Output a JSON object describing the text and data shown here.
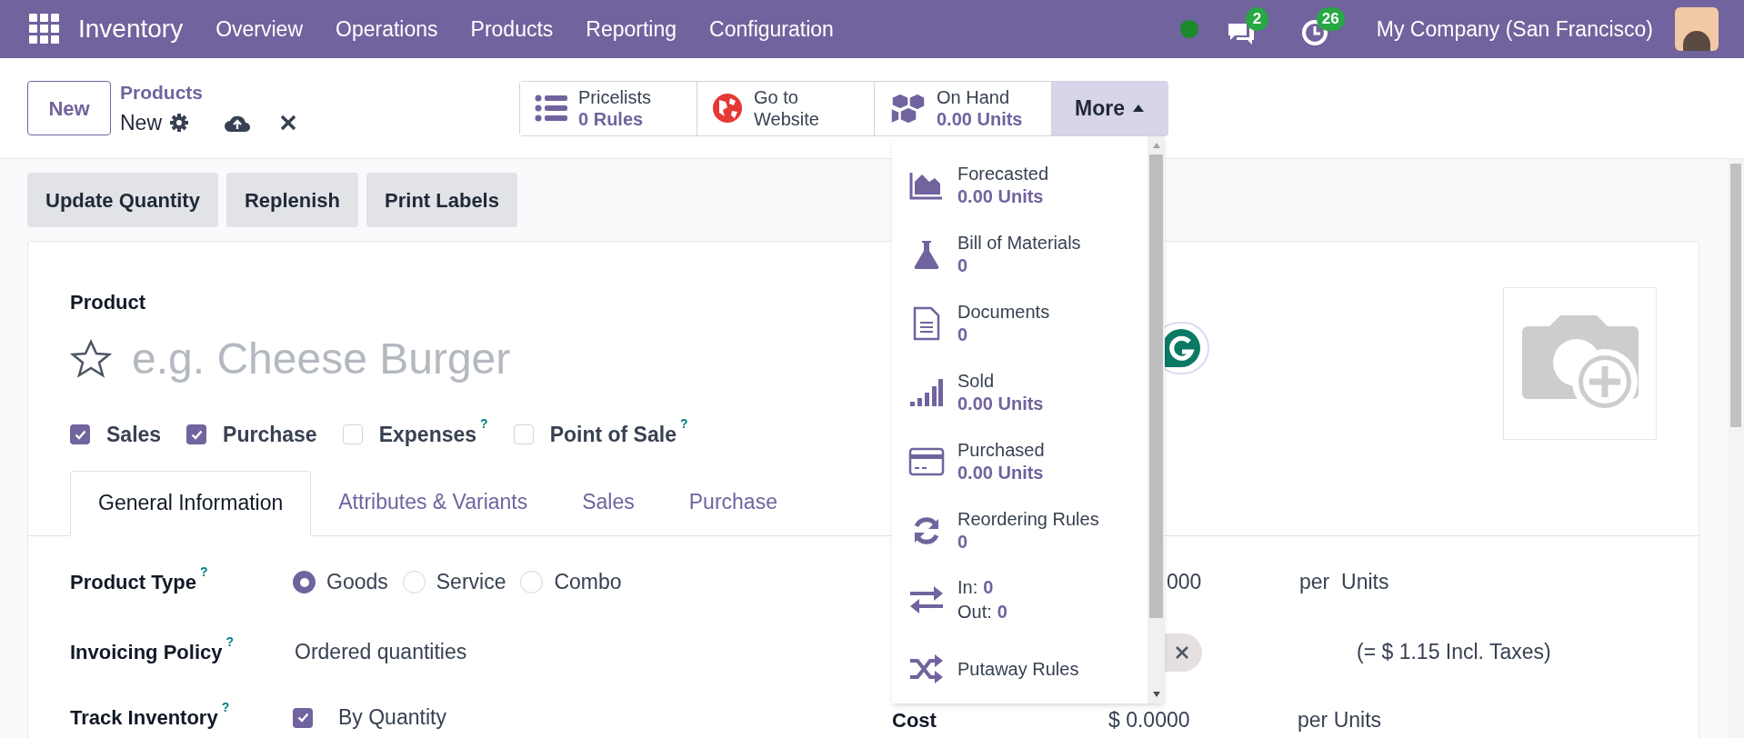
{
  "navbar": {
    "app_name": "Inventory",
    "menu": [
      "Overview",
      "Operations",
      "Products",
      "Reporting",
      "Configuration"
    ],
    "messages_count": "2",
    "activities_count": "26",
    "company": "My Company (San Francisco)"
  },
  "control_panel": {
    "new_button": "New",
    "breadcrumb": "Products",
    "record": "New"
  },
  "smart_buttons": [
    {
      "label": "Pricelists",
      "value": "0",
      "unit": "Rules"
    },
    {
      "label": "Go to",
      "value": "Website"
    },
    {
      "label": "On Hand",
      "value": "0.00",
      "unit": "Units"
    }
  ],
  "more_button": {
    "label": "More",
    "expanded": true
  },
  "more_menu": [
    {
      "kind": "stat",
      "label": "Forecasted",
      "value": "0.00 Units"
    },
    {
      "kind": "stat",
      "label": "Bill of Materials",
      "value": "0"
    },
    {
      "kind": "stat",
      "label": "Documents",
      "value": "0"
    },
    {
      "kind": "stat",
      "label": "Sold",
      "value": "0.00 Units"
    },
    {
      "kind": "stat",
      "label": "Purchased",
      "value": "0.00 Units"
    },
    {
      "kind": "stat",
      "label": "Reordering Rules",
      "value": "0"
    },
    {
      "kind": "inout",
      "lines": [
        {
          "label": "In:",
          "value": "0"
        },
        {
          "label": "Out:",
          "value": "0"
        }
      ]
    },
    {
      "kind": "plain",
      "label": "Putaway Rules"
    }
  ],
  "action_buttons": [
    "Update Quantity",
    "Replenish",
    "Print Labels"
  ],
  "form": {
    "product_label": "Product",
    "favorite": false,
    "name_placeholder": "e.g. Cheese Burger",
    "options": [
      {
        "label": "Sales",
        "checked": true
      },
      {
        "label": "Purchase",
        "checked": true
      },
      {
        "label": "Expenses",
        "checked": false,
        "help": "?"
      },
      {
        "label": "Point of Sale",
        "checked": false,
        "help": "?"
      }
    ],
    "tabs": [
      {
        "label": "General Information",
        "selected": true
      },
      {
        "label": "Attributes & Variants",
        "selected": false
      },
      {
        "label": "Sales",
        "selected": false
      },
      {
        "label": "Purchase",
        "selected": false
      }
    ],
    "product_type": {
      "label": "Product Type",
      "help": "?",
      "choices": [
        {
          "label": "Goods",
          "selected": true
        },
        {
          "label": "Service",
          "selected": false
        },
        {
          "label": "Combo",
          "selected": false
        }
      ]
    },
    "invoicing_policy": {
      "label": "Invoicing Policy",
      "help": "?",
      "value": "Ordered quantities"
    },
    "track_inventory": {
      "label": "Track Inventory",
      "help": "?",
      "checked": true,
      "value": "By Quantity"
    },
    "sales_price": {
      "value": "000",
      "unit": "per  Units",
      "tax_note": "(= $ 1.15 Incl. Taxes)"
    },
    "cost": {
      "label": "Cost",
      "value": "$ 0.0000",
      "unit": "per Units"
    }
  }
}
